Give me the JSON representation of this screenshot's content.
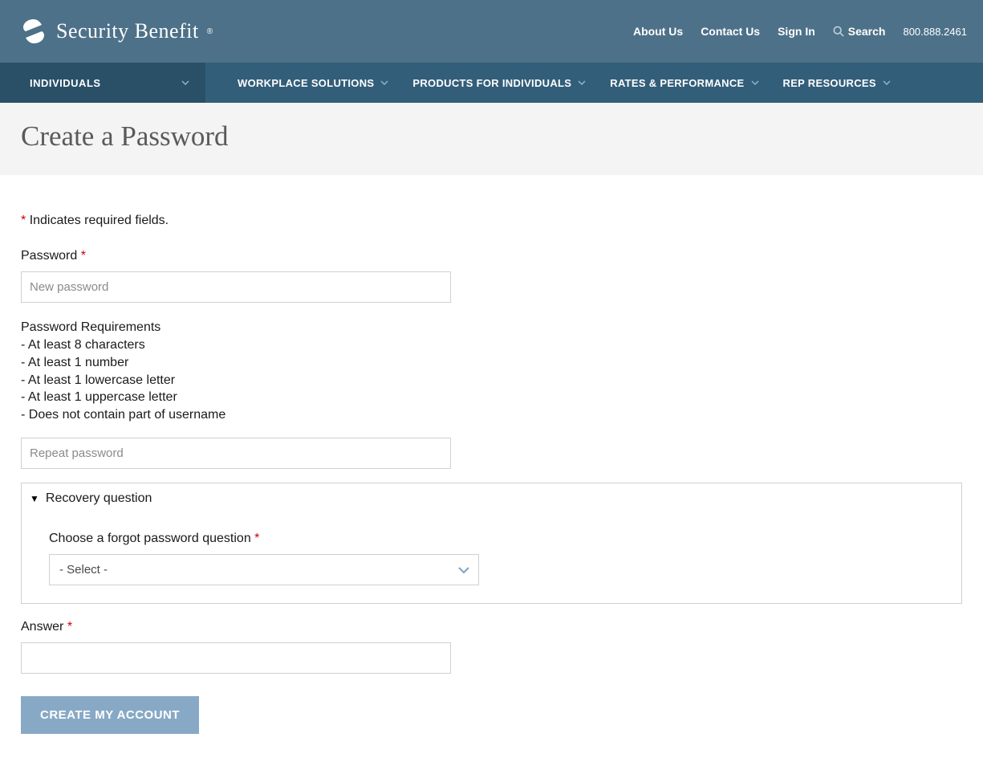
{
  "header": {
    "brand": "Security Benefit",
    "links": {
      "about": "About Us",
      "contact": "Contact Us",
      "signin": "Sign In",
      "search": "Search"
    },
    "phone": "800.888.2461"
  },
  "nav": {
    "individuals": "INDIVIDUALS",
    "items": [
      "WORKPLACE SOLUTIONS",
      "PRODUCTS FOR INDIVIDUALS",
      "RATES & PERFORMANCE",
      "REP RESOURCES"
    ]
  },
  "page": {
    "title": "Create a Password",
    "required_note": "Indicates required fields.",
    "password_label": "Password",
    "password_placeholder": "New password",
    "req_title": "Password Requirements",
    "reqs": [
      "- At least 8 characters",
      "- At least 1 number",
      "- At least 1 lowercase letter",
      "- At least 1 uppercase letter",
      "- Does not contain part of username"
    ],
    "repeat_placeholder": "Repeat password",
    "recovery_title": "Recovery question",
    "question_label": "Choose a forgot password question",
    "select_placeholder": "- Select -",
    "answer_label": "Answer",
    "submit": "CREATE MY ACCOUNT"
  }
}
